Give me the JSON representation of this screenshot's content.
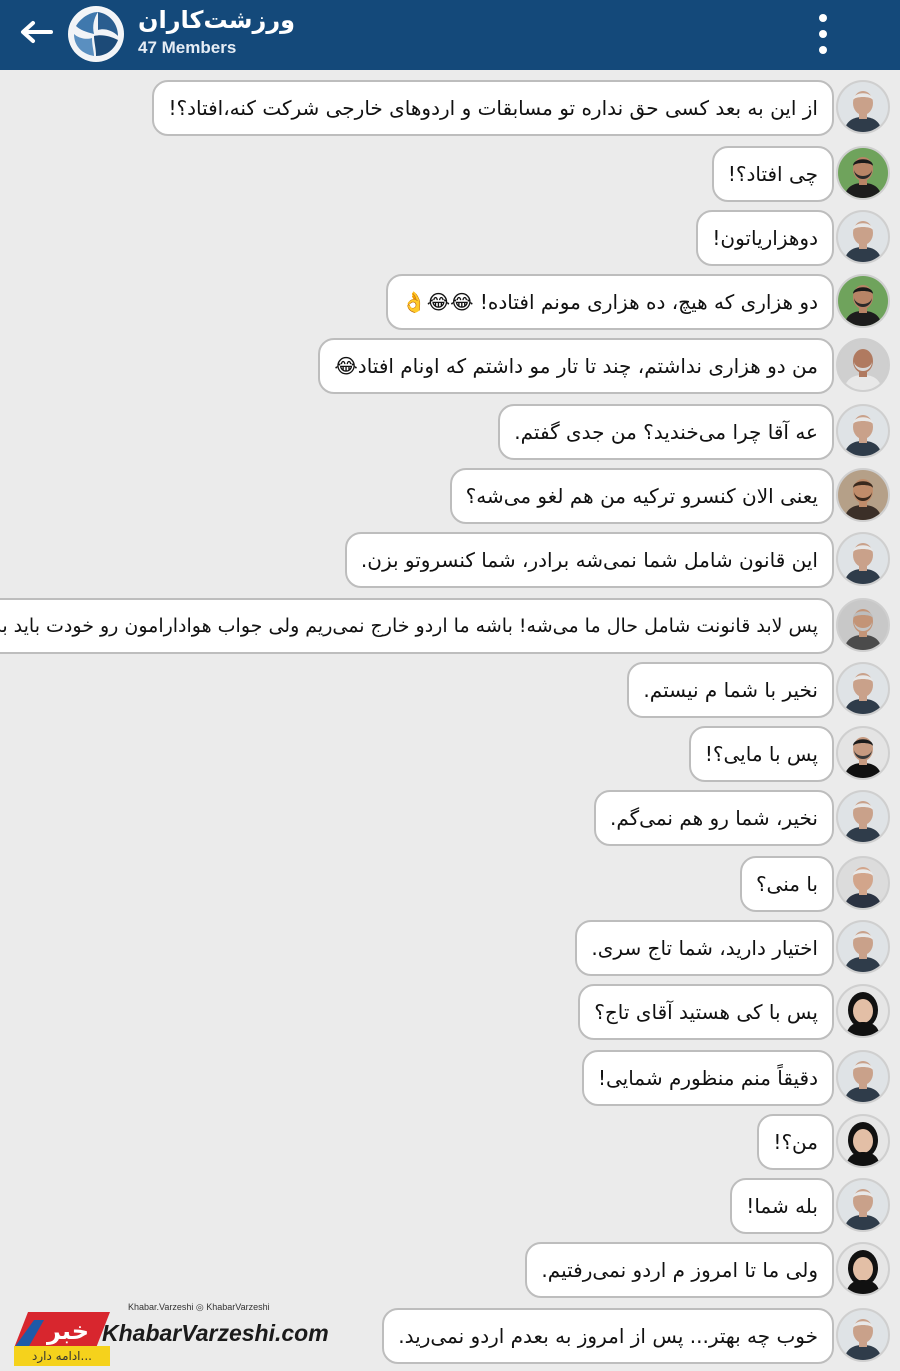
{
  "header": {
    "title": "ورزشت‌کاران",
    "members": "47 Members",
    "back_icon": "arrow-left-icon",
    "menu_icon": "more-vertical-icon",
    "bg_color": "#14497a"
  },
  "messages": [
    {
      "text": "از این به بعد کسی حق نداره تو مسابقات و اردوهای خارجی شرکت کنه،افتاد؟!",
      "sender": "taj"
    },
    {
      "text": "چی افتاد؟!",
      "sender": "young-bearded"
    },
    {
      "text": "دوهزاریاتون!",
      "sender": "taj"
    },
    {
      "text": "دو هزاری که هیچ، ده هزاری مونم افتاده!",
      "emoji": "😂😂👌",
      "sender": "young-bearded"
    },
    {
      "text": "من دو هزاری نداشتم، چند تا تار مو داشتم که اونام افتاد",
      "emoji": "😂",
      "sender": "bald"
    },
    {
      "text": "عه آقا چرا می‌خندید؟ من جدی گفتم.",
      "sender": "taj"
    },
    {
      "text": "یعنی الان کنسرو ترکیه من هم لغو می‌شه؟",
      "sender": "bearded"
    },
    {
      "text": "این قانون شامل شما نمی‌شه برادر، شما کنسروتو بزن.",
      "sender": "taj"
    },
    {
      "text": "پس لابد قانونت شامل حال ما می‌شه! باشه ما اردو خارج نمی‌ریم ولی جواب هوادارامون رو خودت باید بدی.",
      "sender": "old-grey"
    },
    {
      "text": "نخیر با شما م نیستم.",
      "sender": "taj"
    },
    {
      "text": "پس با مایی؟!",
      "sender": "young-shaved"
    },
    {
      "text": "نخیر، شما رو هم نمی‌گم.",
      "sender": "taj"
    },
    {
      "text": "با منی؟",
      "sender": "grey-hair"
    },
    {
      "text": "اختیار دارید، شما تاج سری.",
      "sender": "taj"
    },
    {
      "text": "پس با کی هستید آقای تاج؟",
      "sender": "woman"
    },
    {
      "text": "دقیقاً منم منظورم شمایی!",
      "sender": "taj"
    },
    {
      "text": "من؟!",
      "sender": "woman"
    },
    {
      "text": "بله شما!",
      "sender": "taj"
    },
    {
      "text": "ولی ما تا امروز م اردو نمی‌رفتیم.",
      "sender": "woman"
    },
    {
      "text": "خوب چه بهتر... پس از امروز به بعدم اردو نمی‌رید.",
      "sender": "taj"
    }
  ],
  "watermark": {
    "site": "KhabarVarzeshi.com",
    "social": "Khabar.Varzeshi  ◎ KhabarVarzeshi",
    "logo_text": "خبر",
    "tag": "ادامه دارد..."
  }
}
